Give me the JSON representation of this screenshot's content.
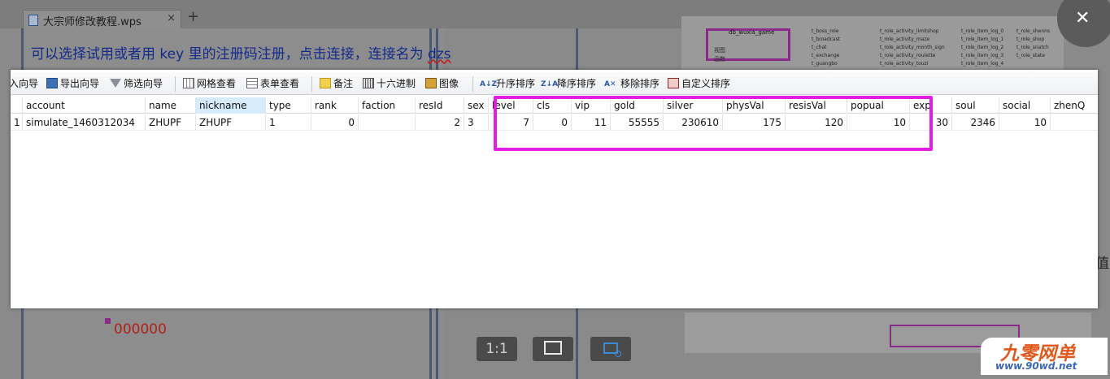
{
  "background": {
    "tab_title": "大宗师修改教程.wps",
    "tab_close": "×",
    "new_tab": "+",
    "guide_text_a": "可以选择试用或者用 key 里的注册码注册，点击连接，连接名为 ",
    "guide_text_b": "dzs",
    "red_value": "000000",
    "side_char": "值",
    "thumb_db_name": "db_wuxia_game",
    "thumb_tree": [
      "视图",
      "函数"
    ],
    "thumb_tables": [
      "t_boss_role",
      "t_broadcast",
      "t_chat",
      "t_exchange",
      "t_guangbo"
    ],
    "thumb_tables_2": [
      "t_role_activity_limitshop",
      "t_role_activity_maze",
      "t_role_activity_month_sign",
      "t_role_activity_roulette",
      "t_role_activity_touzi"
    ],
    "thumb_tables_3": [
      "t_role_item_log_0",
      "t_role_item_log_1",
      "t_role_item_log_2",
      "t_role_item_log_3",
      "t_role_item_log_4"
    ],
    "thumb_tables_4": [
      "t_role_shenns",
      "t_role_shop",
      "t_role_snatch",
      "t_role_state"
    ]
  },
  "viewer": {
    "close_label": "✕",
    "btn_1to1": "1:1"
  },
  "toolbar": {
    "import_wizard": "入向导",
    "export_wizard": "导出向导",
    "filter_wizard": "筛选向导",
    "grid_view": "网格查看",
    "form_view": "表单查看",
    "memo": "备注",
    "hex": "十六进制",
    "image": "图像",
    "sort_asc": "升序排序",
    "sort_desc": "降序排序",
    "remove_sort": "移除排序",
    "custom_sort": "自定义排序",
    "sort_asc_glyph": "A↓Z",
    "sort_desc_glyph": "Z↓A",
    "remove_sort_glyph": "A✕"
  },
  "grid": {
    "columns": [
      "account",
      "name",
      "nickname",
      "type",
      "rank",
      "faction",
      "resId",
      "sex",
      "level",
      "cls",
      "vip",
      "gold",
      "silver",
      "physVal",
      "resisVal",
      "popual",
      "exp",
      "soul",
      "social",
      "zhenQ"
    ],
    "row": {
      "index": "1",
      "account": "simulate_1460312034",
      "name": "ZHUPF",
      "nickname": "ZHUPF",
      "type": "1",
      "rank": "0",
      "faction": "",
      "resId": "2",
      "sex": "3",
      "level": "7",
      "cls": "0",
      "vip": "11",
      "gold": "55555",
      "silver": "230610",
      "physVal": "175",
      "resisVal": "120",
      "popual": "10",
      "exp": "30",
      "soul": "2346",
      "social": "10",
      "zhenQ": ""
    },
    "highlight_color": "#e31ee3"
  },
  "watermark": {
    "title": "九零网单",
    "url": "www.90wd.net"
  }
}
